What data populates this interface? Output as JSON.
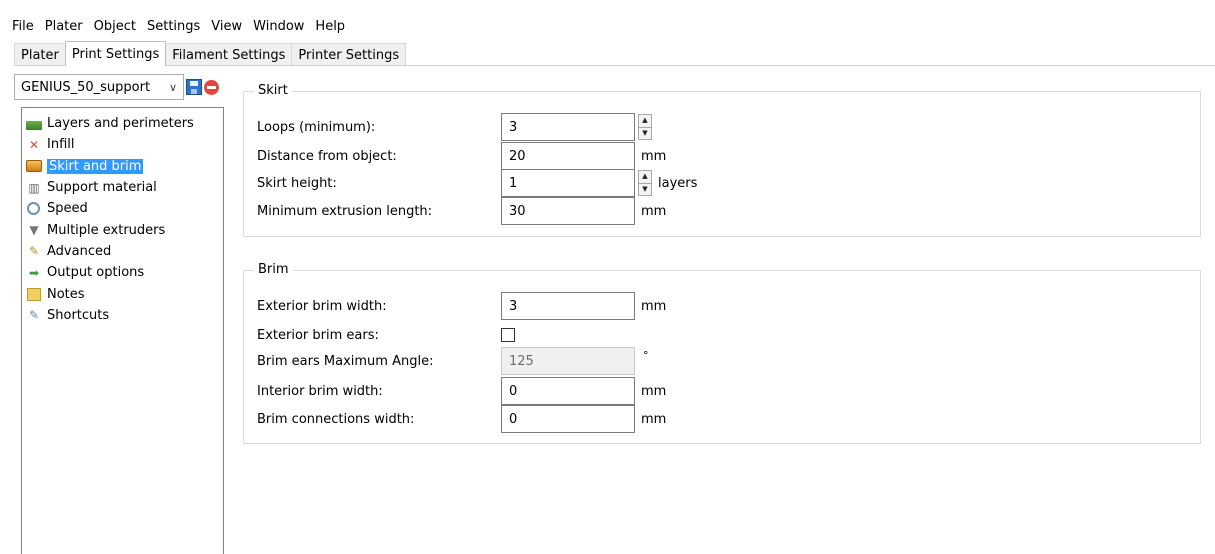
{
  "menu": [
    "File",
    "Plater",
    "Object",
    "Settings",
    "View",
    "Window",
    "Help"
  ],
  "tabs": [
    {
      "label": "Plater",
      "active": false
    },
    {
      "label": "Print Settings",
      "active": true
    },
    {
      "label": "Filament Settings",
      "active": false
    },
    {
      "label": "Printer Settings",
      "active": false
    }
  ],
  "preset": {
    "selected": "GENIUS_50_support",
    "icons": [
      "save-icon",
      "delete-icon"
    ]
  },
  "tree": [
    {
      "label": "Layers and perimeters",
      "icon": "layers-icon",
      "selected": false
    },
    {
      "label": "Infill",
      "icon": "infill-icon",
      "selected": false
    },
    {
      "label": "Skirt and brim",
      "icon": "skirt-icon",
      "selected": true
    },
    {
      "label": "Support material",
      "icon": "support-material-icon",
      "selected": false
    },
    {
      "label": "Speed",
      "icon": "speed-icon",
      "selected": false
    },
    {
      "label": "Multiple extruders",
      "icon": "extruder-funnel-icon",
      "selected": false
    },
    {
      "label": "Advanced",
      "icon": "wrench-icon",
      "selected": false
    },
    {
      "label": "Output options",
      "icon": "output-arrow-icon",
      "selected": false
    },
    {
      "label": "Notes",
      "icon": "notes-icon",
      "selected": false
    },
    {
      "label": "Shortcuts",
      "icon": "shortcuts-wrench-icon",
      "selected": false
    }
  ],
  "skirt": {
    "title": "Skirt",
    "loops_label": "Loops (minimum):",
    "loops_value": "3",
    "distance_label": "Distance from object:",
    "distance_value": "20",
    "distance_unit": "mm",
    "height_label": "Skirt height:",
    "height_value": "1",
    "height_unit": "layers",
    "min_extrusion_label": "Minimum extrusion length:",
    "min_extrusion_value": "30",
    "min_extrusion_unit": "mm"
  },
  "brim": {
    "title": "Brim",
    "ext_width_label": "Exterior brim width:",
    "ext_width_value": "3",
    "ext_width_unit": "mm",
    "ears_label": "Exterior brim ears:",
    "ears_checked": false,
    "ears_angle_label": "Brim ears Maximum Angle:",
    "ears_angle_value": "125",
    "ears_angle_unit": "°",
    "int_width_label": "Interior brim width:",
    "int_width_value": "0",
    "int_width_unit": "mm",
    "connections_label": "Brim connections width:",
    "connections_value": "0",
    "connections_unit": "mm"
  },
  "colors": {
    "selection": "#3399ff",
    "border": "#828282",
    "group_border": "#dcdcdc"
  }
}
